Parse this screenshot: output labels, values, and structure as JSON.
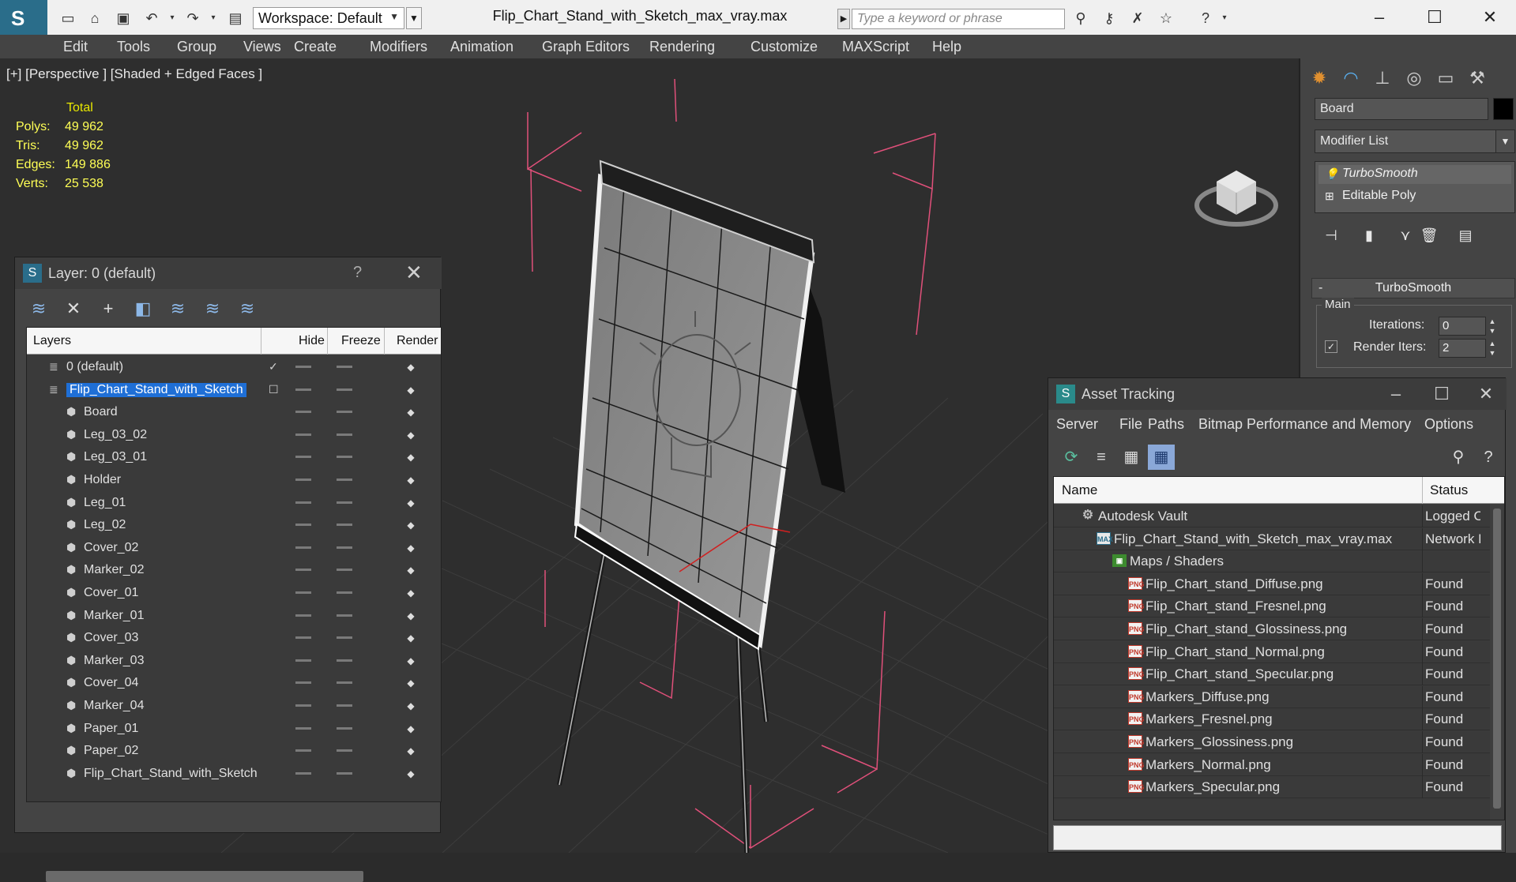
{
  "titlebar": {
    "workspace_label": "Workspace: Default",
    "document_title": "Flip_Chart_Stand_with_Sketch_max_vray.max",
    "search_placeholder": "Type a keyword or phrase"
  },
  "menubar": {
    "items": [
      "Edit",
      "Tools",
      "Group",
      "Views",
      "Create",
      "Modifiers",
      "Animation",
      "Graph Editors",
      "Rendering",
      "Customize",
      "MAXScript",
      "Help"
    ]
  },
  "viewport": {
    "label": "[+] [Perspective ] [Shaded + Edged Faces ]",
    "stats": {
      "header": "Total",
      "rows": [
        {
          "k": "Polys:",
          "v": "49 962"
        },
        {
          "k": "Tris:",
          "v": "49 962"
        },
        {
          "k": "Edges:",
          "v": "149 886"
        },
        {
          "k": "Verts:",
          "v": "25 538"
        }
      ]
    }
  },
  "command_panel": {
    "object_name": "Board",
    "modifier_list_label": "Modifier List",
    "stack": [
      "TurboSmooth",
      "Editable Poly"
    ],
    "rollout_title": "TurboSmooth",
    "group_label": "Main",
    "iterations_label": "Iterations:",
    "iterations_value": "0",
    "render_iters_label": "Render Iters:",
    "render_iters_value": "2",
    "render_iters_checked": true
  },
  "layer_dialog": {
    "title": "Layer: 0 (default)",
    "help": "?",
    "columns": [
      "Layers",
      "Hide",
      "Freeze",
      "Render"
    ],
    "layers": [
      {
        "name": "0 (default)",
        "level": 0,
        "current": true
      },
      {
        "name": "Flip_Chart_Stand_with_Sketch",
        "level": 0,
        "selected": true
      },
      {
        "name": "Board",
        "level": 1
      },
      {
        "name": "Leg_03_02",
        "level": 1
      },
      {
        "name": "Leg_03_01",
        "level": 1
      },
      {
        "name": "Holder",
        "level": 1
      },
      {
        "name": "Leg_01",
        "level": 1
      },
      {
        "name": "Leg_02",
        "level": 1
      },
      {
        "name": "Cover_02",
        "level": 1
      },
      {
        "name": "Marker_02",
        "level": 1
      },
      {
        "name": "Cover_01",
        "level": 1
      },
      {
        "name": "Marker_01",
        "level": 1
      },
      {
        "name": "Cover_03",
        "level": 1
      },
      {
        "name": "Marker_03",
        "level": 1
      },
      {
        "name": "Cover_04",
        "level": 1
      },
      {
        "name": "Marker_04",
        "level": 1
      },
      {
        "name": "Paper_01",
        "level": 1
      },
      {
        "name": "Paper_02",
        "level": 1
      },
      {
        "name": "Flip_Chart_Stand_with_Sketch",
        "level": 1
      }
    ]
  },
  "asset_dialog": {
    "title": "Asset Tracking",
    "menu": [
      "Server",
      "File",
      "Paths",
      "Bitmap Performance and Memory",
      "Options"
    ],
    "columns": [
      "Name",
      "Status"
    ],
    "rows": [
      {
        "name": "Autodesk Vault",
        "status": "Logged Out",
        "icon": "vault",
        "level": 0
      },
      {
        "name": "Flip_Chart_Stand_with_Sketch_max_vray.max",
        "status": "Network Path",
        "icon": "max",
        "level": 1
      },
      {
        "name": "Maps / Shaders",
        "status": "",
        "icon": "maps",
        "level": 2
      },
      {
        "name": "Flip_Chart_stand_Diffuse.png",
        "status": "Found",
        "icon": "png",
        "level": 3
      },
      {
        "name": "Flip_Chart_stand_Fresnel.png",
        "status": "Found",
        "icon": "png",
        "level": 3
      },
      {
        "name": "Flip_Chart_stand_Glossiness.png",
        "status": "Found",
        "icon": "png",
        "level": 3
      },
      {
        "name": "Flip_Chart_stand_Normal.png",
        "status": "Found",
        "icon": "png",
        "level": 3
      },
      {
        "name": "Flip_Chart_stand_Specular.png",
        "status": "Found",
        "icon": "png",
        "level": 3
      },
      {
        "name": "Markers_Diffuse.png",
        "status": "Found",
        "icon": "png",
        "level": 3
      },
      {
        "name": "Markers_Fresnel.png",
        "status": "Found",
        "icon": "png",
        "level": 3
      },
      {
        "name": "Markers_Glossiness.png",
        "status": "Found",
        "icon": "png",
        "level": 3
      },
      {
        "name": "Markers_Normal.png",
        "status": "Found",
        "icon": "png",
        "level": 3
      },
      {
        "name": "Markers_Specular.png",
        "status": "Found",
        "icon": "png",
        "level": 3
      }
    ]
  },
  "colors": {
    "accent_blue": "#1f6fd6",
    "stats_yellow": "#ffff55",
    "helper_pink": "#e0507a"
  }
}
